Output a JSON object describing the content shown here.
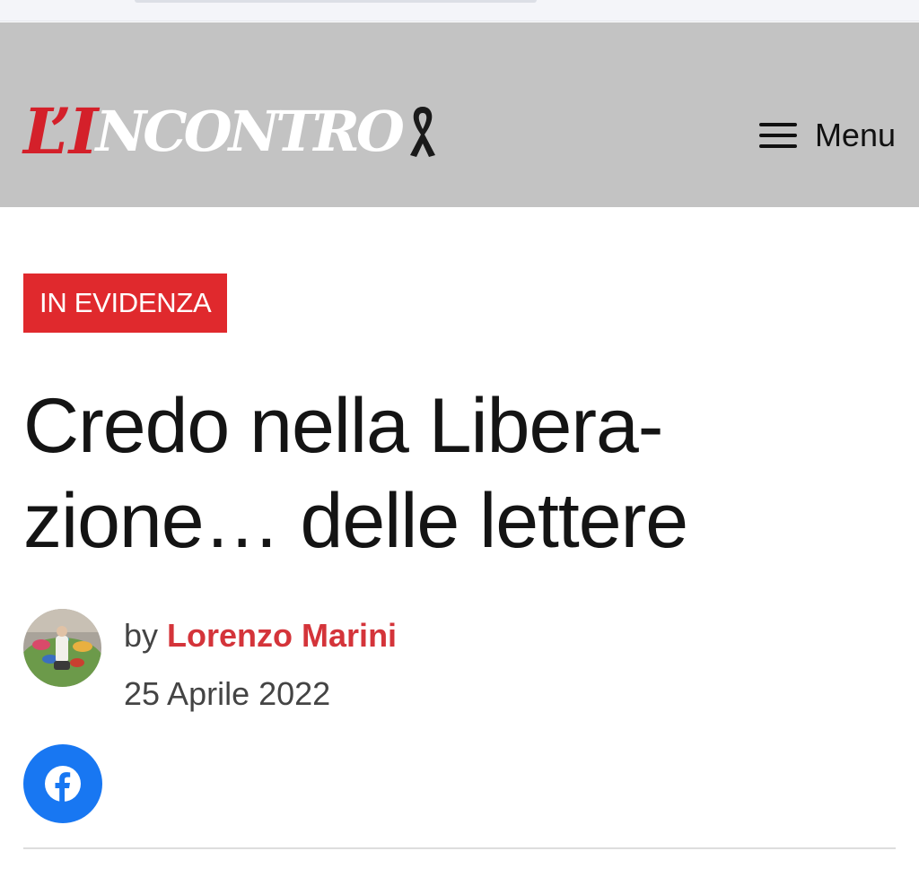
{
  "header": {
    "logo": {
      "prefix": "L’I",
      "rest": "NCONTRO"
    },
    "menu_label": "Menu"
  },
  "article": {
    "category": "IN EVIDENZA",
    "title_line1": "Credo nella Libera-",
    "title_line2": "zione… delle lettere",
    "byline_prefix": "by",
    "author": "Lorenzo Marini",
    "date": "25 Aprile 2022"
  },
  "share": {
    "icon": "facebook-icon"
  },
  "colors": {
    "header_bg": "#c3c3c3",
    "brand_red": "#e0292d",
    "author_red": "#d4343a",
    "facebook_blue": "#1877f2",
    "title_text": "#141414"
  }
}
